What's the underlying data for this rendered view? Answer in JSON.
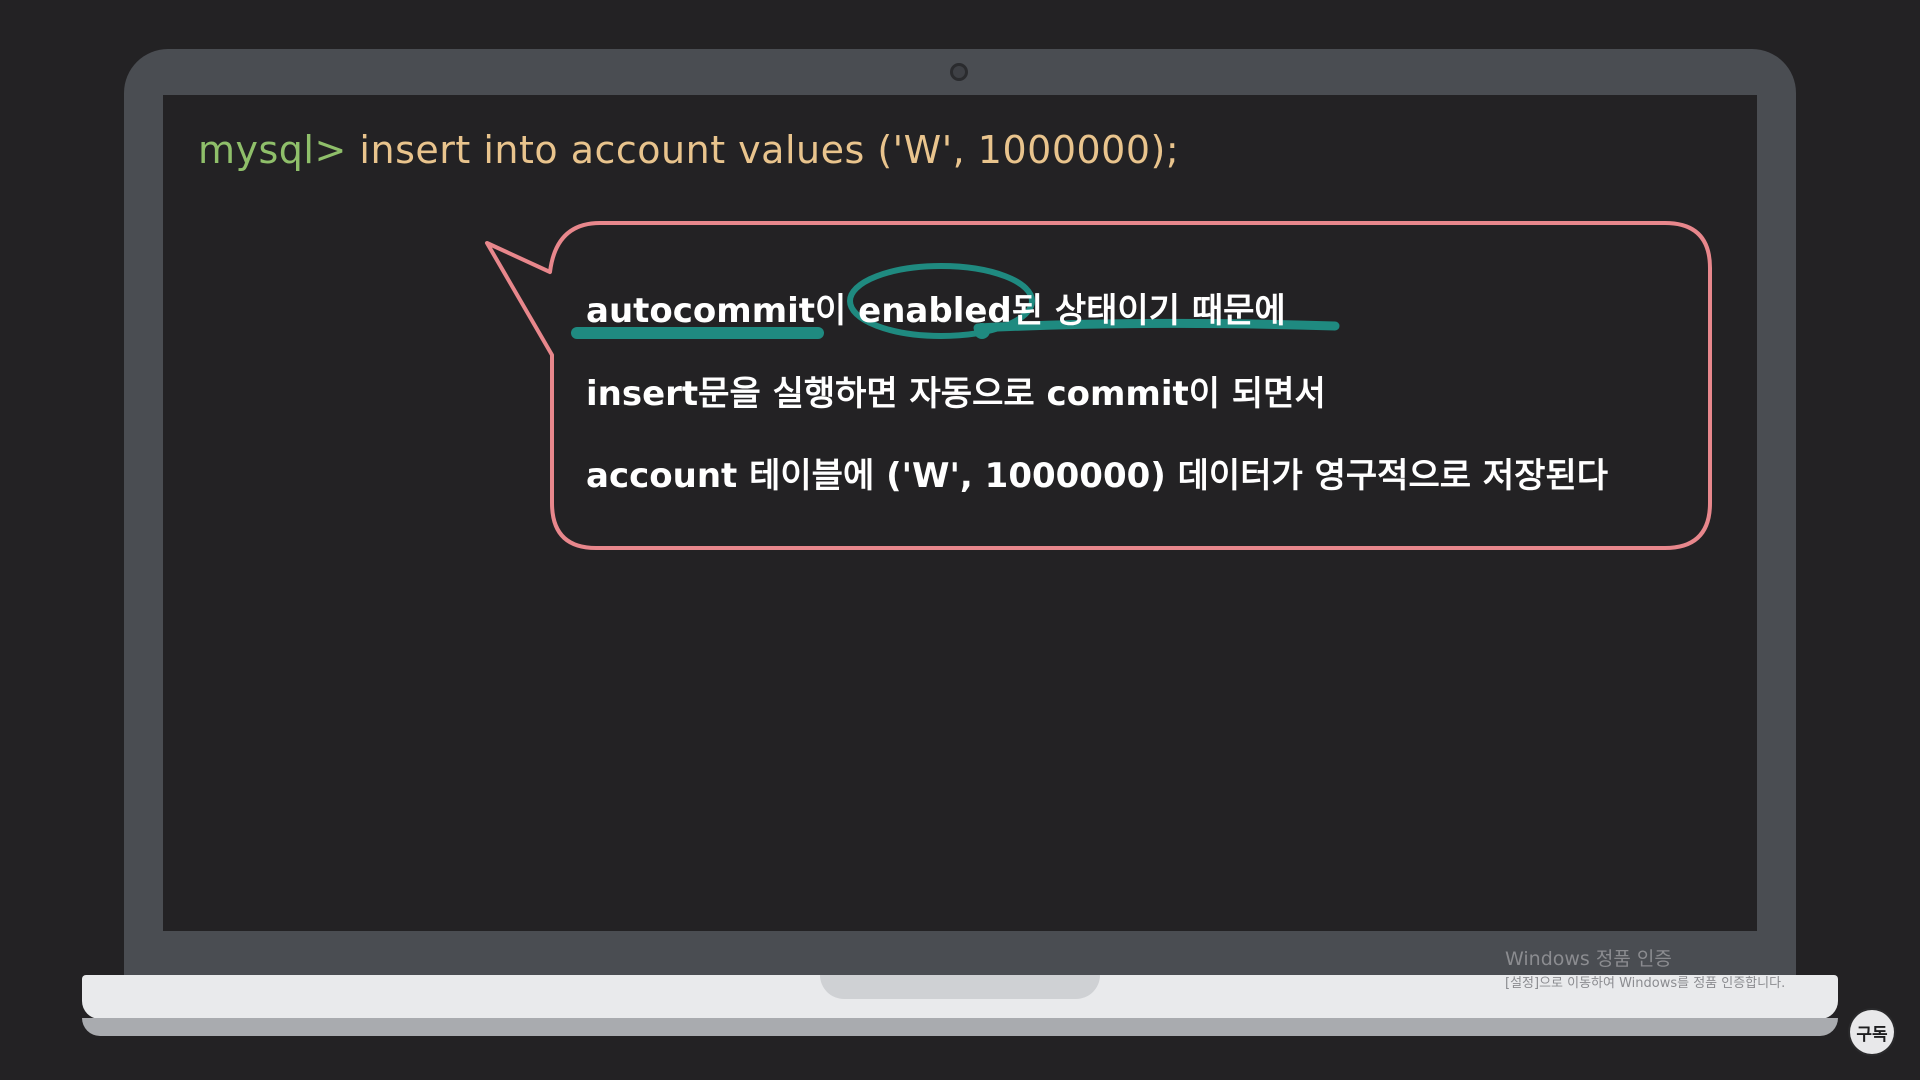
{
  "terminal": {
    "prompt": "mysql>",
    "command": "insert into account values ('W', 1000000);"
  },
  "bubble": {
    "lines": [
      "autocommit이 enabled된 상태이기 때문에",
      "insert문을 실행하면 자동으로 commit이 되면서",
      "account 테이블에 ('W', 1000000) 데이터가 영구적으로 저장된다"
    ],
    "border_color": "#e8878c",
    "highlight_color": "#1f8a80"
  },
  "watermark": {
    "title": "Windows 정품 인증",
    "subtitle": "[설정]으로 이동하여 Windows를 정품 인증합니다."
  },
  "subscribe": {
    "label": "구독"
  },
  "colors": {
    "background": "#232224",
    "laptop_frame": "#4a4d52",
    "prompt": "#8fbf6a",
    "command": "#e9c48d"
  }
}
